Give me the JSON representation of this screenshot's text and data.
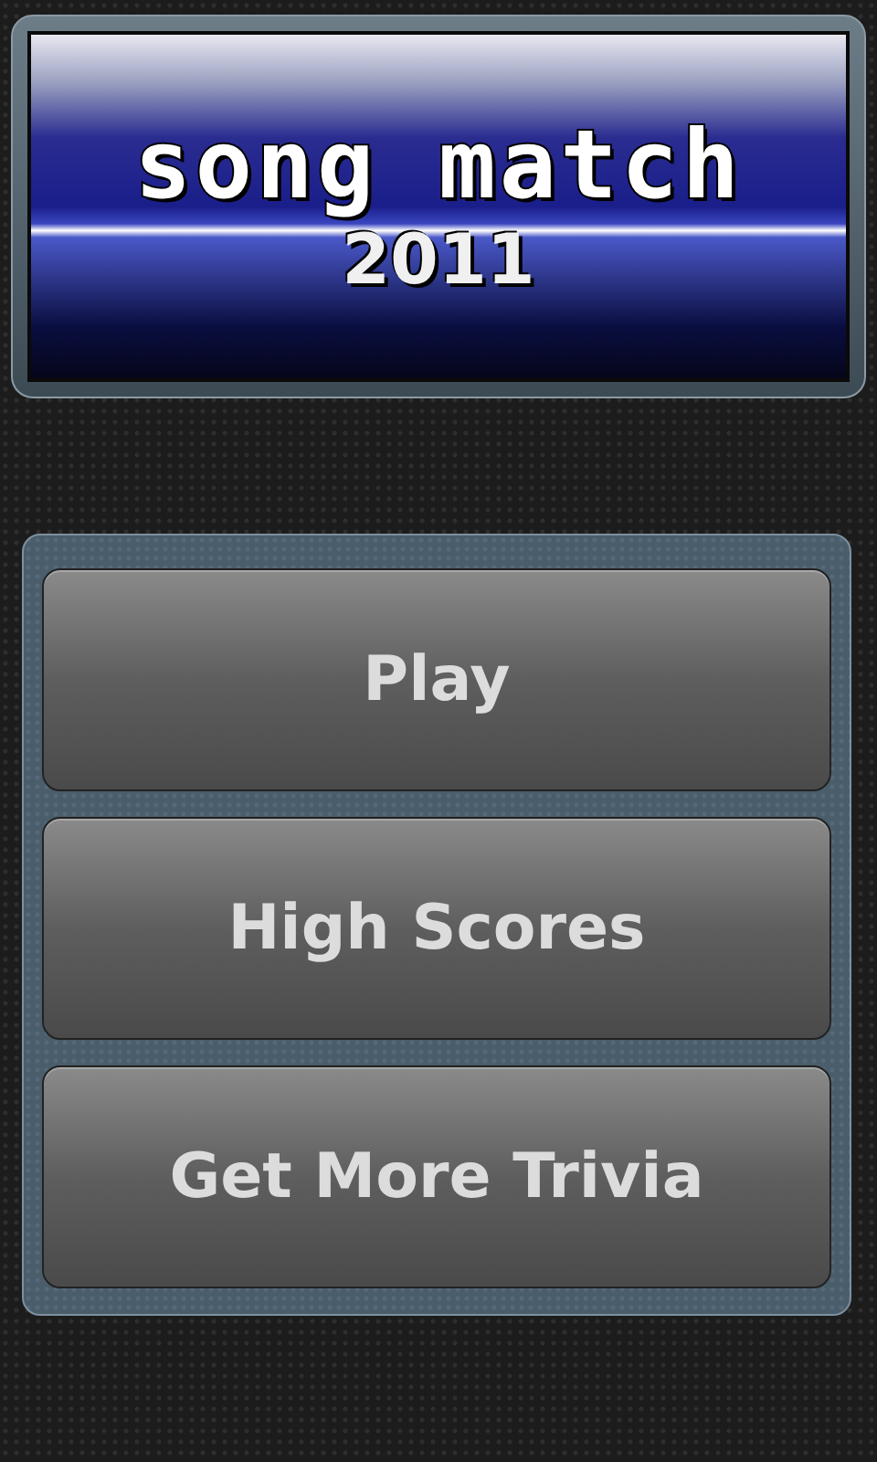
{
  "logo": {
    "title": "song match",
    "year": "2011"
  },
  "buttons": [
    "Play",
    "High Scores",
    "Get More Trivia"
  ]
}
